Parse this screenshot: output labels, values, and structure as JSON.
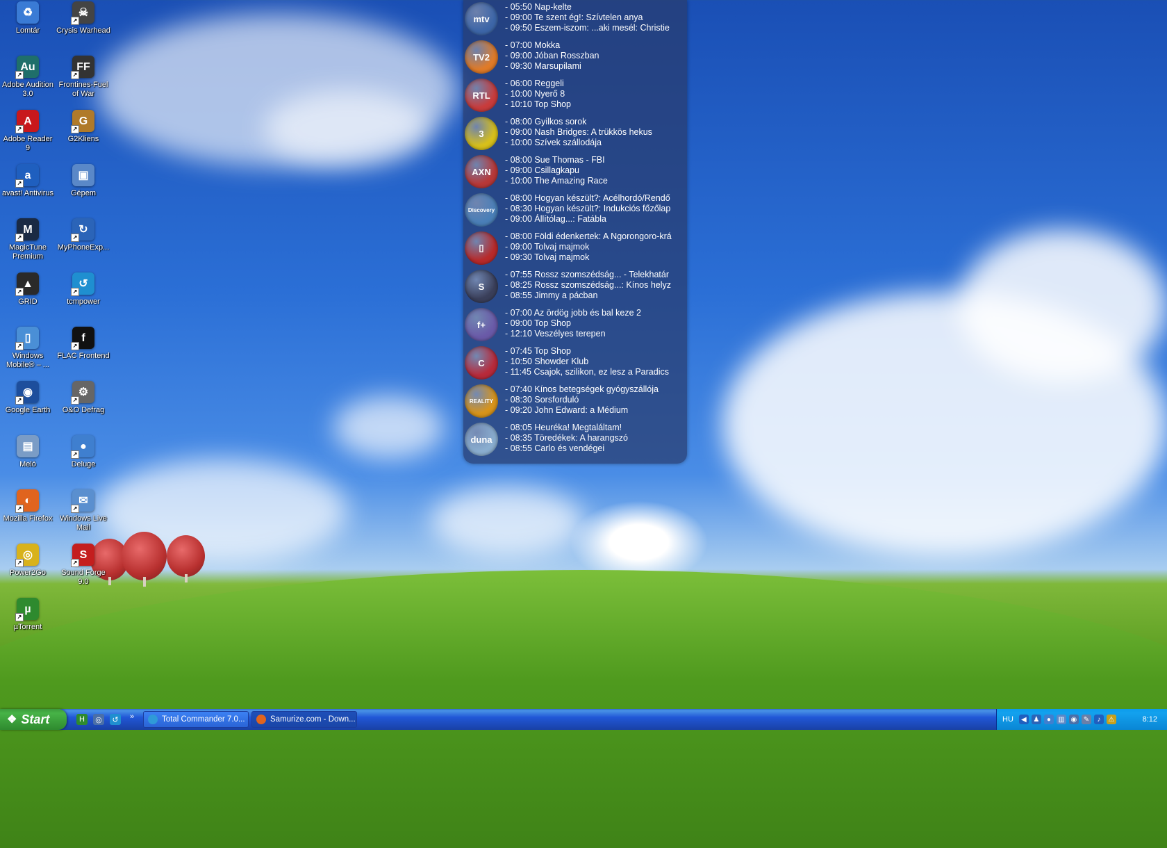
{
  "desktop": {
    "icons": [
      {
        "label": "Lomtár",
        "glyph": "♻",
        "color": "#3a7bd5",
        "icon": "recycle-bin-icon"
      },
      {
        "label": "Crysis Warhead",
        "glyph": "☠",
        "color": "#444444",
        "icon": "crysis-warhead-icon"
      },
      {
        "label": "Adobe Audition 3.0",
        "glyph": "Au",
        "color": "#1f6f6a",
        "icon": "adobe-audition-icon"
      },
      {
        "label": "Frontines-Fuel of War",
        "glyph": "FF",
        "color": "#333333",
        "icon": "frontlines-icon"
      },
      {
        "label": "Adobe Reader 9",
        "glyph": "A",
        "color": "#c8181c",
        "icon": "adobe-reader-icon"
      },
      {
        "label": "G2Kliens",
        "glyph": "G",
        "color": "#b07a2a",
        "icon": "g2kliens-icon"
      },
      {
        "label": "avast! Antivirus",
        "glyph": "a",
        "color": "#1f5fbf",
        "icon": "avast-icon"
      },
      {
        "label": "Gépem",
        "glyph": "▣",
        "color": "#5a88c8",
        "icon": "my-computer-icon"
      },
      {
        "label": "MagicTune Premium",
        "glyph": "M",
        "color": "#1a2a44",
        "icon": "magictune-icon"
      },
      {
        "label": "MyPhoneExp...",
        "glyph": "↻",
        "color": "#2b64b8",
        "icon": "myphoneexplorer-icon"
      },
      {
        "label": "GRID",
        "glyph": "▲",
        "color": "#2a2a2a",
        "icon": "grid-game-icon"
      },
      {
        "label": "tcmpower",
        "glyph": "↺",
        "color": "#1f8fd0",
        "icon": "tcmpower-icon"
      },
      {
        "label": "Windows Mobile® – ...",
        "glyph": "▯",
        "color": "#4a8fd6",
        "icon": "windows-mobile-icon"
      },
      {
        "label": "FLAC Frontend",
        "glyph": "f",
        "color": "#111111",
        "icon": "flac-frontend-icon"
      },
      {
        "label": "Google Earth",
        "glyph": "◉",
        "color": "#1d4e9c",
        "icon": "google-earth-icon"
      },
      {
        "label": "O&O Defrag",
        "glyph": "⚙",
        "color": "#666666",
        "icon": "oo-defrag-icon"
      },
      {
        "label": "Meló",
        "glyph": "▤",
        "color": "#7a9cc6",
        "icon": "melo-folder-icon"
      },
      {
        "label": "Deluge",
        "glyph": "●",
        "color": "#3f7fcf",
        "icon": "deluge-icon"
      },
      {
        "label": "Mozilla Firefox",
        "glyph": "◐",
        "color": "#e0641e",
        "icon": "firefox-icon"
      },
      {
        "label": "Windows Live Mail",
        "glyph": "✉",
        "color": "#5a8fcf",
        "icon": "windows-live-mail-icon"
      },
      {
        "label": "Power2Go",
        "glyph": "◎",
        "color": "#d8b21c",
        "icon": "power2go-icon"
      },
      {
        "label": "Sound Forge 9.0",
        "glyph": "S",
        "color": "#c41e1e",
        "icon": "sound-forge-icon"
      },
      {
        "label": "µTorrent",
        "glyph": "µ",
        "color": "#2e8a2e",
        "icon": "utorrent-icon"
      }
    ]
  },
  "tv_guide": {
    "channels": [
      {
        "logo": "mtv",
        "color": "#3d66a8",
        "icon": "mtv-logo-icon",
        "programs": [
          "- 05:50 Nap-kelte",
          "- 09:00 Te szent ég!: Szívtelen anya",
          "- 09:50 Eszem-iszom: ...aki mesél: Christie"
        ]
      },
      {
        "logo": "TV2",
        "color": "#e07b28",
        "icon": "tv2-logo-icon",
        "programs": [
          "- 07:00 Mokka",
          "- 09:00 Jóban Rosszban",
          "- 09:30 Marsupilami"
        ]
      },
      {
        "logo": "RTL",
        "color": "#c83c3c",
        "icon": "rtl-logo-icon",
        "programs": [
          "- 06:00 Reggeli",
          "- 10:00 Nyerő 8",
          "- 10:10 Top Shop"
        ]
      },
      {
        "logo": "3",
        "color": "#d8c01a",
        "icon": "viasat3-logo-icon",
        "programs": [
          "- 08:00 Gyilkos sorok",
          "- 09:00 Nash Bridges: A trükkös hekus",
          "- 10:00 Szívek szállodája"
        ]
      },
      {
        "logo": "AXN",
        "color": "#b83838",
        "icon": "axn-logo-icon",
        "programs": [
          "- 08:00 Sue Thomas - FBI",
          "- 09:00 Csillagkapu",
          "- 10:00 The Amazing Race"
        ]
      },
      {
        "logo": "Discovery",
        "color": "#4a7fb8",
        "icon": "discovery-logo-icon",
        "programs": [
          "- 08:00 Hogyan készült?: Acélhordó/Rendő",
          "- 08:30 Hogyan készült?: Indukciós főzőlap",
          "- 09:00 Állítólag...: Fatábla"
        ]
      },
      {
        "logo": "▯",
        "color": "#b82a2a",
        "icon": "national-geographic-logo-icon",
        "programs": [
          "- 08:00 Földi édenkertek: A Ngorongoro-krá",
          "- 09:00 Tolvaj majmok",
          "- 09:30 Tolvaj majmok"
        ]
      },
      {
        "logo": "S",
        "color": "#3a3f5a",
        "icon": "spektrum-logo-icon",
        "programs": [
          "- 07:55 Rossz szomszédság... - Telekhatár",
          "- 08:25 Rossz szomszédság...: Kínos helyz",
          "- 08:55 Jimmy a pácban"
        ]
      },
      {
        "logo": "f+",
        "color": "#6a5aa8",
        "icon": "film-plus-logo-icon",
        "programs": [
          "- 07:00 Az ördög jobb és bal keze 2",
          "- 09:00 Top Shop",
          "- 12:10 Veszélyes terepen"
        ]
      },
      {
        "logo": "C",
        "color": "#b82a3a",
        "icon": "cool-tv-logo-icon",
        "programs": [
          "- 07:45 Top Shop",
          "- 10:50 Showder Klub",
          "- 11:45 Csajok, szilikon, ez lesz a Paradics"
        ]
      },
      {
        "logo": "REALITY",
        "color": "#d8941a",
        "icon": "reality-tv-logo-icon",
        "programs": [
          "- 07:40 Kínos betegségek gyógyszállója",
          "- 08:30 Sorsforduló",
          "- 09:20 John Edward: a Médium"
        ]
      },
      {
        "logo": "duna",
        "color": "#8aaed0",
        "icon": "duna-tv-logo-icon",
        "programs": [
          "- 08:05 Heuréka! Megtaláltam!",
          "- 08:35 Töredékek: A harangszó",
          "- 08:55 Carlo és vendégei"
        ]
      }
    ]
  },
  "taskbar": {
    "start_label": "Start",
    "quicklaunch": [
      {
        "glyph": "H",
        "color": "#2e8a2e",
        "icon": "quicklaunch-app-icon"
      },
      {
        "glyph": "◎",
        "color": "#4a6fa8",
        "icon": "quicklaunch-browser-icon"
      },
      {
        "glyph": "↺",
        "color": "#1f8fd0",
        "icon": "quicklaunch-refresh-icon"
      }
    ],
    "overflow": "»",
    "tasks": [
      {
        "label": "Total Commander 7.0...",
        "color": "#2f9ad8",
        "icon": "total-commander-icon"
      },
      {
        "label": "Samurize.com - Down...",
        "color": "#e0641e",
        "icon": "firefox-icon"
      }
    ],
    "tray": {
      "lang": "HU",
      "icons": [
        {
          "glyph": "◀",
          "color": "#1f5fbf",
          "icon": "tray-arrow-icon"
        },
        {
          "glyph": "♟",
          "color": "#2b64b8",
          "icon": "tray-network-icon"
        },
        {
          "glyph": "●",
          "color": "#3f7fcf",
          "icon": "tray-deluge-icon"
        },
        {
          "glyph": "▥",
          "color": "#5a88c8",
          "icon": "tray-display-icon"
        },
        {
          "glyph": "◉",
          "color": "#4a6fa8",
          "icon": "tray-app-icon"
        },
        {
          "glyph": "✎",
          "color": "#6a7fa8",
          "icon": "tray-notes-icon"
        },
        {
          "glyph": "♪",
          "color": "#1f5fbf",
          "icon": "tray-volume-icon"
        },
        {
          "glyph": "⚠",
          "color": "#c8a01a",
          "icon": "tray-warning-icon"
        }
      ],
      "clock": "8:12"
    }
  }
}
